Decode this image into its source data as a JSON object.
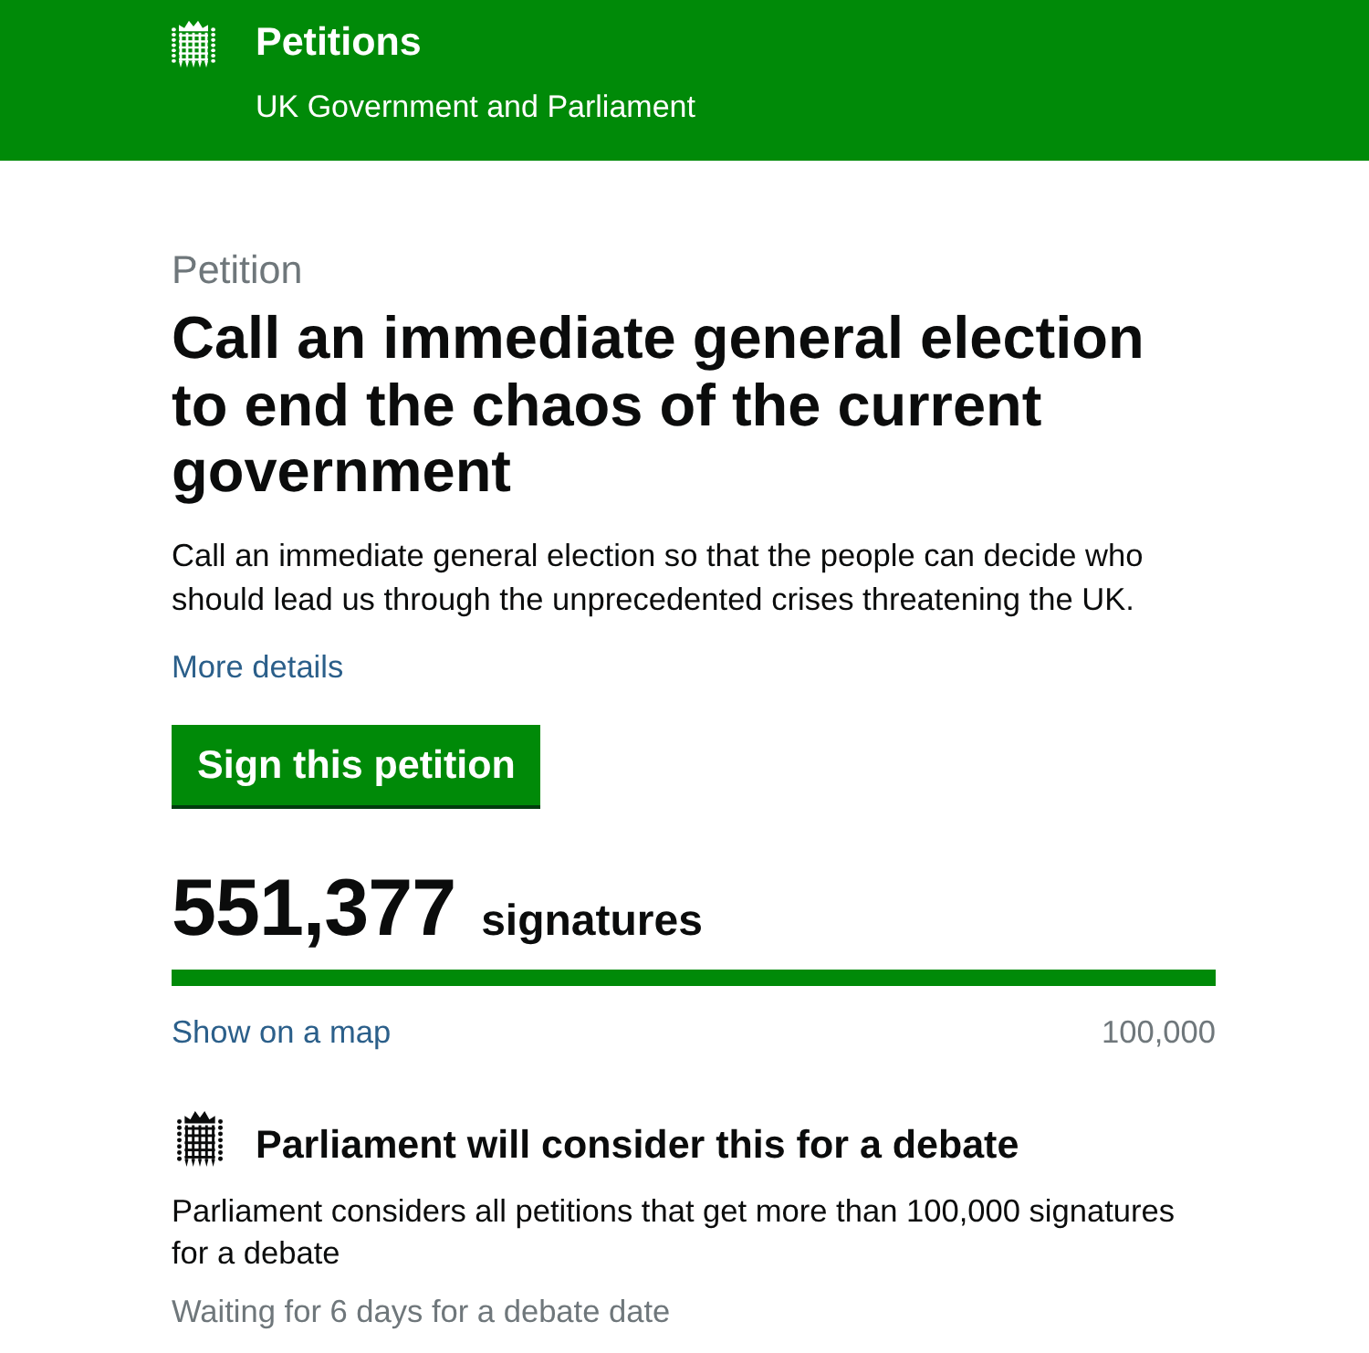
{
  "header": {
    "title": "Petitions",
    "subtitle": "UK Government and Parliament"
  },
  "petition": {
    "label": "Petition",
    "title": "Call an immediate general election to end the chaos of the current government",
    "description": "Call an immediate general election so that the people can decide who should lead us through the unprecedented crises threatening the UK.",
    "more_link": "More details",
    "sign_button": "Sign this petition"
  },
  "signatures": {
    "count": "551,377",
    "unit": "signatures",
    "progress": {
      "level": 1
    },
    "map_link": "Show on a map",
    "threshold": "100,000"
  },
  "debate": {
    "heading": "Parliament will consider this for a debate",
    "text": "Parliament considers all petitions that get more than 100,000 signatures for a debate",
    "status": "Waiting for 6 days for a debate date"
  }
}
